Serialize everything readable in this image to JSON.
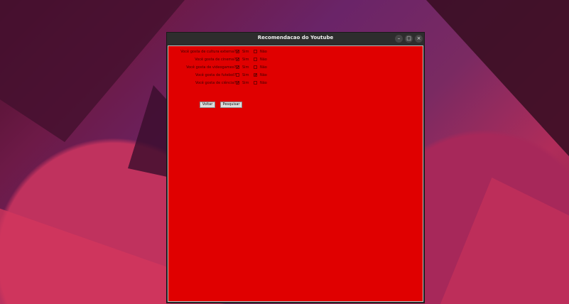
{
  "window": {
    "title": "Recomendacao do Youtube",
    "controls": {
      "minimize": "–",
      "maximize": "□",
      "close": "×"
    }
  },
  "questions": [
    {
      "label": "Você gosta de cultura externa?",
      "sim": "Sim",
      "nao": "Não",
      "sim_checked": true,
      "nao_checked": false
    },
    {
      "label": "Você gosta de cinema?",
      "sim": "Sim",
      "nao": "Não",
      "sim_checked": true,
      "nao_checked": false
    },
    {
      "label": "Você gosta de videogames?",
      "sim": "Sim",
      "nao": "Não",
      "sim_checked": true,
      "nao_checked": false
    },
    {
      "label": "Você gosta de futebol?",
      "sim": "Sim",
      "nao": "Não",
      "sim_checked": false,
      "nao_checked": true
    },
    {
      "label": "Você gosta de ciência?",
      "sim": "Sim",
      "nao": "Não",
      "sim_checked": true,
      "nao_checked": false
    }
  ],
  "buttons": {
    "back": "Voltar",
    "search": "Pesquisar"
  },
  "check_glyph": "✔",
  "colors": {
    "content_bg": "#e00000",
    "titlebar": "#2d2d2d"
  }
}
